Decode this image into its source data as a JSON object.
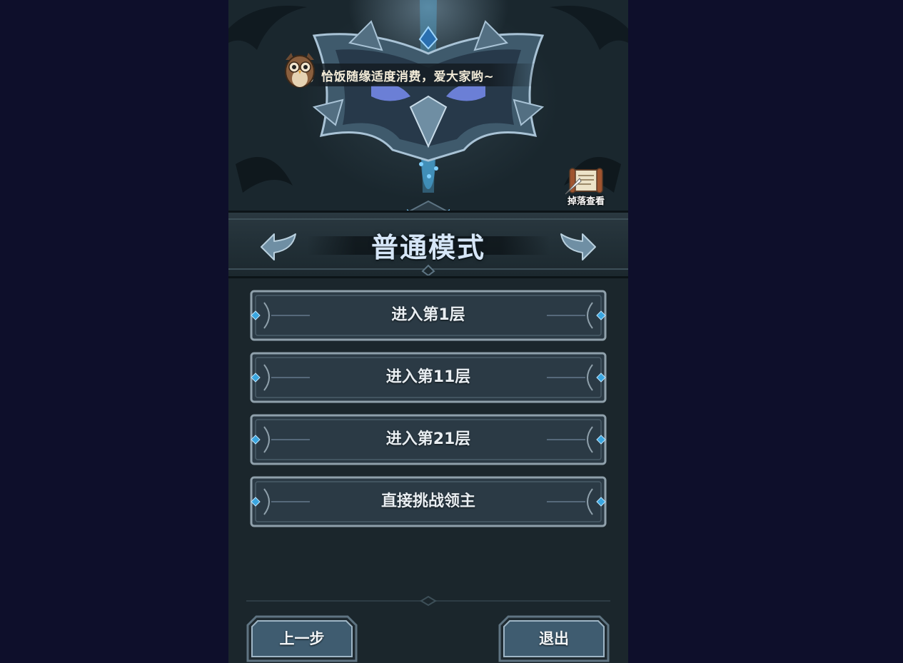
{
  "marquee": {
    "text": "开，恰饭随缘适度消费，爱大家哟~"
  },
  "drop_view": {
    "label": "掉落查看"
  },
  "mode": {
    "title": "普通模式"
  },
  "floors": [
    {
      "label": "进入第1层"
    },
    {
      "label": "进入第11层"
    },
    {
      "label": "进入第21层"
    },
    {
      "label": "直接挑战领主"
    }
  ],
  "buttons": {
    "back": "上一步",
    "exit": "退出"
  },
  "colors": {
    "background": "#0e0f2b",
    "panel": "#1b262c",
    "button_face": "#2b3a45",
    "button_border": "#8fa0ab",
    "gem_accent": "#3aa6e0",
    "title_text": "#d6e6f7"
  },
  "icons": {
    "owl": "owl-mascot-icon",
    "scroll": "scroll-quill-icon",
    "left_arrow": "arrow-left-icon",
    "right_arrow": "arrow-right-icon"
  }
}
